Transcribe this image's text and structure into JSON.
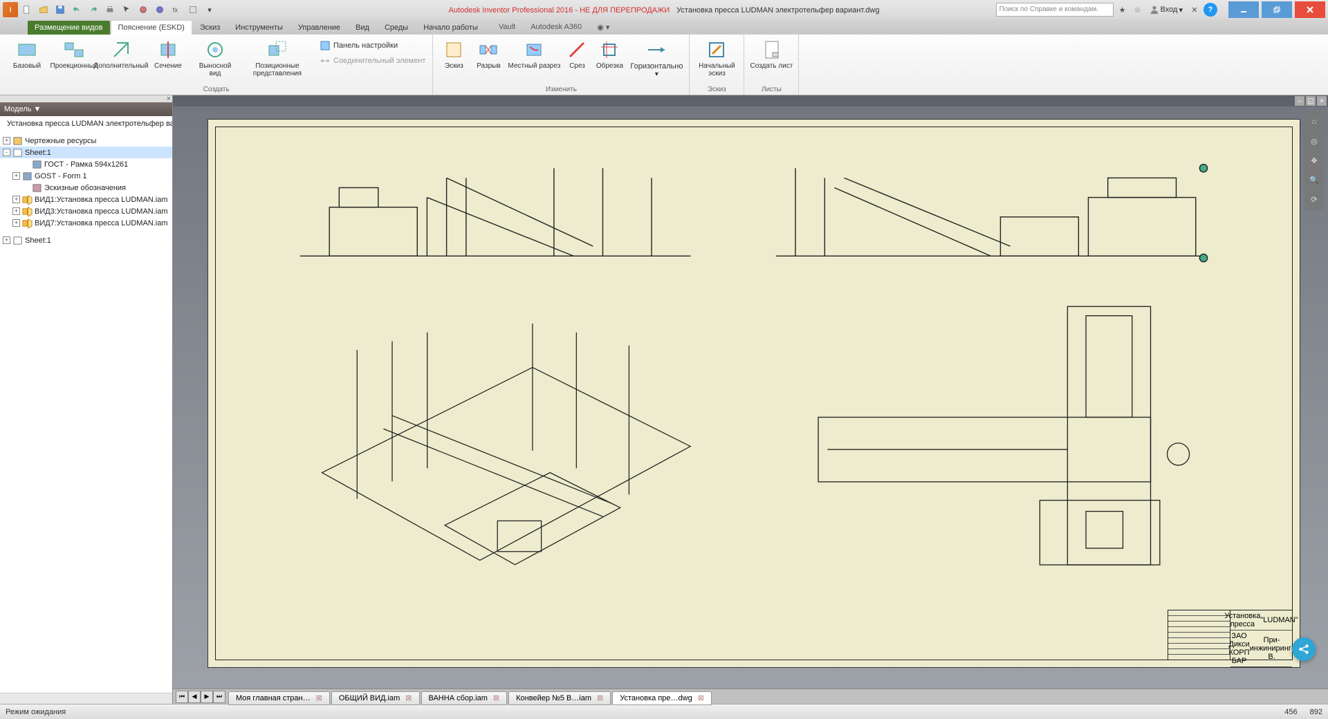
{
  "title": {
    "app": "Autodesk Inventor Professional 2016 - НЕ ДЛЯ ПЕРЕПРОДАЖИ",
    "doc": "Установка пресса LUDMAN электротельфер вариант.dwg",
    "search_placeholder": "Поиск по Справке и командам.",
    "login": "Вход"
  },
  "qat": [
    "new",
    "open",
    "save",
    "undo",
    "redo",
    "print",
    "arrow",
    "props",
    "mat",
    "color",
    "home",
    "dd"
  ],
  "tabs": {
    "main": "Размещение видов",
    "items": [
      "Пояснение (ESKD)",
      "Эскиз",
      "Инструменты",
      "Управление",
      "Вид",
      "Среды",
      "Начало работы",
      "Vault",
      "Autodesk A360"
    ]
  },
  "ribbon": {
    "create": {
      "label": "Создать",
      "buttons": [
        "Базовый",
        "Проекционный",
        "Дополнительный",
        "Сечение",
        "Выносной вид",
        "Позиционные представления"
      ],
      "panel_settings": "Панель настройки",
      "connector": "Соединительный элемент"
    },
    "modify": {
      "label": "Изменить",
      "buttons": [
        "Эскиз",
        "Разрыв",
        "Местный разрез",
        "Срез",
        "Обрезка",
        "Горизонтально"
      ]
    },
    "sketch": {
      "label": "Эскиз",
      "button": "Начальный эскиз"
    },
    "sheets": {
      "label": "Листы",
      "button": "Создать лист"
    }
  },
  "browser": {
    "title": "Модель ▼",
    "items": [
      {
        "exp": "",
        "ic": "dwg",
        "label": "Установка пресса LUDMAN электротельфер вариант.dw",
        "indent": 0
      },
      {
        "exp": "+",
        "ic": "folder",
        "label": "Чертежные ресурсы",
        "indent": 0,
        "gap": true
      },
      {
        "exp": "-",
        "ic": "sheet",
        "label": "Sheet:1",
        "indent": 0,
        "sel": true
      },
      {
        "exp": "",
        "ic": "frame",
        "label": "ГОСТ - Рамка 594x1261",
        "indent": 2
      },
      {
        "exp": "+",
        "ic": "frame",
        "label": "GOST - Form 1",
        "indent": 1
      },
      {
        "exp": "",
        "ic": "sk",
        "label": "Эскизные обозначения",
        "indent": 2
      },
      {
        "exp": "+",
        "ic": "view",
        "label": "ВИД1:Установка пресса LUDMAN.iam",
        "indent": 1
      },
      {
        "exp": "+",
        "ic": "view",
        "label": "ВИД3:Установка пресса LUDMAN.iam",
        "indent": 1
      },
      {
        "exp": "+",
        "ic": "view",
        "label": "ВИД7:Установка пресса LUDMAN.iam",
        "indent": 1
      },
      {
        "exp": "+",
        "ic": "sheet",
        "label": "Sheet:1",
        "indent": 0,
        "gap": true
      }
    ]
  },
  "titleblock": {
    "name1": "Установка пресса",
    "name2": "\"LUDMAN\"",
    "org1": "ЗАО Дикси КОРП БАР",
    "org2": "При-инжиниринг-В."
  },
  "doc_tabs": {
    "items": [
      {
        "label": "Моя главная стран…",
        "active": false
      },
      {
        "label": "ОБЩИЙ ВИД.iam",
        "active": false
      },
      {
        "label": "ВАННА сбор.iam",
        "active": false
      },
      {
        "label": "Конвейер №5 В…iam",
        "active": false
      },
      {
        "label": "Установка пре…dwg",
        "active": true
      }
    ]
  },
  "status": {
    "left": "Режим ожидания",
    "x": "456",
    "y": "892"
  }
}
